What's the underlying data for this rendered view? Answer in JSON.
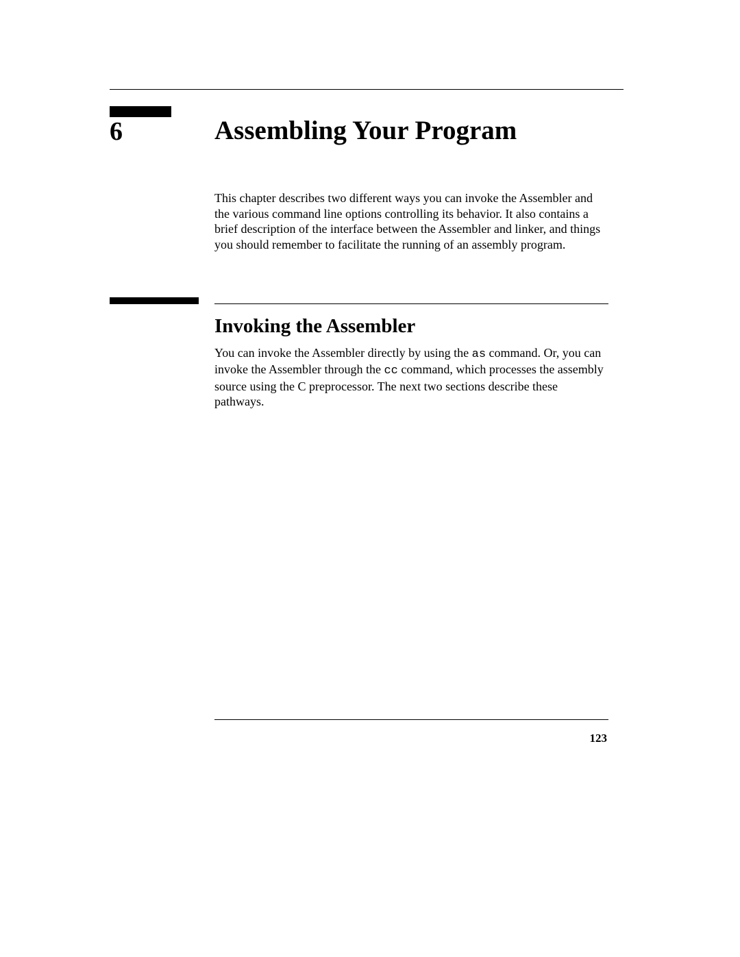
{
  "chapter": {
    "number": "6",
    "title": "Assembling Your Program",
    "intro": "This chapter describes two different ways you can invoke the Assembler and the various command line options controlling its behavior. It also contains a brief description of the interface between the Assembler and linker, and things you should remember to facilitate the running of an assembly program."
  },
  "section": {
    "title": "Invoking the Assembler",
    "text_parts": {
      "p1": "You can invoke the Assembler directly by using the ",
      "cmd1": "as",
      "p2": " command. Or, you can invoke the Assembler through the ",
      "cmd2": "cc",
      "p3": " command, which processes the assembly source using the C preprocessor. The next two sections describe these pathways."
    }
  },
  "page_number": "123"
}
